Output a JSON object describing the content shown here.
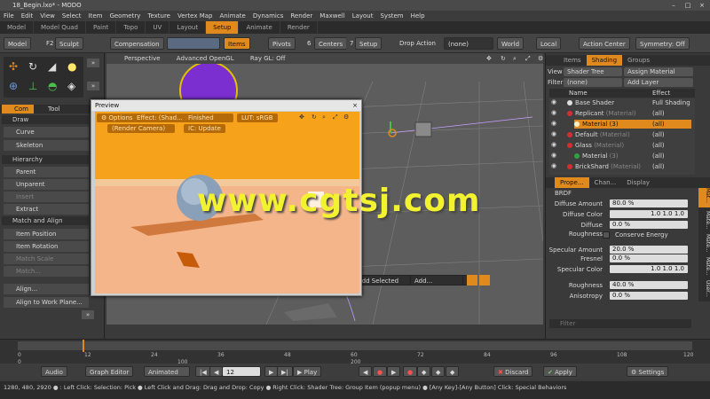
{
  "window": {
    "title": "18_Begin.lxo* - MODO",
    "controls": [
      "minimize",
      "maximize",
      "close"
    ]
  },
  "menu": [
    "File",
    "Edit",
    "View",
    "Select",
    "Item",
    "Geometry",
    "Texture",
    "Vertex Map",
    "Animate",
    "Dynamics",
    "Render",
    "Maxwell",
    "Layout",
    "System",
    "Help"
  ],
  "layout_tabs": [
    {
      "label": "Model",
      "active": false
    },
    {
      "label": "Model Quad",
      "active": false
    },
    {
      "label": "Paint",
      "active": false
    },
    {
      "label": "Topo",
      "active": false
    },
    {
      "label": "UV",
      "active": false
    },
    {
      "label": "Layout",
      "active": false
    },
    {
      "label": "Setup",
      "active": true
    },
    {
      "label": "Animate",
      "active": false
    },
    {
      "label": "Render",
      "active": false
    }
  ],
  "toolbar": {
    "model": "Model",
    "model_key": "F2",
    "sculpt": "Sculpt",
    "compensation": "Compensation",
    "items": "Items",
    "pivots": "Pivots",
    "pivots_num": "6",
    "centers": "Centers",
    "centers_num": "7",
    "setup": "Setup",
    "drop_action": "Drop Action",
    "drop_value": "(none)",
    "world": "World",
    "local": "Local",
    "action_center": "Action Center",
    "symmetry": "Symmetry: Off"
  },
  "left_panel": {
    "tabs": [
      "Com",
      "Tool"
    ],
    "sections": [
      {
        "header": "Draw",
        "items": [
          {
            "label": "Curve",
            "dim": false
          },
          {
            "label": "Skeleton",
            "dim": false
          }
        ]
      },
      {
        "header": "Hierarchy",
        "items": [
          {
            "label": "Parent",
            "dim": false
          },
          {
            "label": "Unparent",
            "dim": false
          },
          {
            "label": "Insert",
            "dim": true
          },
          {
            "label": "Extract",
            "dim": false
          }
        ]
      },
      {
        "header": "Match and Align",
        "items": [
          {
            "label": "Item Position",
            "dim": false
          },
          {
            "label": "Item Rotation",
            "dim": false
          },
          {
            "label": "Match Scale",
            "dim": true
          },
          {
            "label": "Match...",
            "dim": true
          }
        ]
      },
      {
        "header": "",
        "items": [
          {
            "label": "Align...",
            "dim": false
          },
          {
            "label": "Align to Work Plane...",
            "dim": false
          }
        ]
      }
    ]
  },
  "viewport": {
    "labels": [
      "Perspective",
      "Advanced OpenGL",
      "Ray GL: Off"
    ],
    "bottom_buttons": [
      "Add Selected",
      "Add..."
    ]
  },
  "preview": {
    "title": "Preview",
    "options": "Options",
    "effect": "Effect: (Shad...",
    "status": "Finished",
    "lut": "LUT: sRGB",
    "camera": "(Render Camera)",
    "ic": "IC: Update"
  },
  "right_panel": {
    "top_tabs": [
      {
        "label": "Items",
        "active": false
      },
      {
        "label": "Shading",
        "active": true
      },
      {
        "label": "Groups",
        "active": false
      }
    ],
    "view_label": "View",
    "view_value": "Shader Tree",
    "assign_material": "Assign Material",
    "filter_label": "Filter",
    "filter_value": "(none)",
    "add_layer": "Add Layer",
    "col_name": "Name",
    "col_effect": "Effect",
    "tree": [
      {
        "name": "Base Shader",
        "type": "",
        "effect": "Full Shading",
        "color": "#dddddd",
        "indent": 0,
        "selected": false
      },
      {
        "name": "Replicant",
        "type": "(Material)",
        "effect": "(all)",
        "color": "#d03030",
        "indent": 0,
        "selected": false
      },
      {
        "name": "Material",
        "type": "(3)",
        "effect": "(all)",
        "color": "#e08a1e",
        "indent": 1,
        "selected": true
      },
      {
        "name": "Default",
        "type": "(Material)",
        "effect": "(all)",
        "color": "#d03030",
        "indent": 0,
        "selected": false
      },
      {
        "name": "Glass",
        "type": "(Material)",
        "effect": "(all)",
        "color": "#d03030",
        "indent": 0,
        "selected": false
      },
      {
        "name": "Material",
        "type": "(3)",
        "effect": "(all)",
        "color": "#30a040",
        "indent": 1,
        "selected": false
      },
      {
        "name": "BrickShard",
        "type": "(Material)",
        "effect": "(all)",
        "color": "#d03030",
        "indent": 0,
        "selected": false
      }
    ],
    "prop_tabs": [
      {
        "label": "Prope...",
        "active": true
      },
      {
        "label": "Chan...",
        "active": false
      },
      {
        "label": "Display",
        "active": false
      }
    ],
    "section": "BRDF",
    "properties": [
      {
        "label": "Diffuse Amount",
        "value": "80.0 %"
      },
      {
        "label": "Diffuse Color",
        "value": "1.0    1.0    1.0"
      },
      {
        "label": "Diffuse Roughness",
        "value": "0.0 %"
      },
      {
        "label": "",
        "value": "Conserve Energy"
      },
      {
        "label": "Specular Amount",
        "value": "20.0 %"
      },
      {
        "label": "Fresnel",
        "value": "0.0 %"
      },
      {
        "label": "Specular Color",
        "value": "1.0    1.0    1.0"
      },
      {
        "label": "Roughness",
        "value": "40.0 %"
      },
      {
        "label": "Anisotropy",
        "value": "0.0 %"
      }
    ],
    "side_tabs": [
      "Mat...",
      "Mate...",
      "Mate...",
      "Mate...",
      "User..."
    ],
    "filter_placeholder": "Filter"
  },
  "timeline": {
    "ticks": [
      "0",
      "12",
      "24",
      "36",
      "48",
      "60",
      "72",
      "84",
      "96",
      "108",
      "120"
    ],
    "footer_ticks": [
      "0",
      "100",
      "200"
    ]
  },
  "transport": {
    "audio": "Audio",
    "graph_editor": "Graph Editor",
    "animated": "Animated",
    "frame": "12",
    "play": "Play",
    "discard": "Discard",
    "apply": "Apply",
    "settings": "Settings"
  },
  "status": "1280, 480, 2920 ● : Left Click: Selection: Pick ● Left Click and Drag: Drag and Drop: Copy ● Right Click: Shader Tree: Group Item (popup menu) ● [Any Key]-[Any Button] Click: Special Behaviors",
  "watermark": "www.cgtsj.com",
  "colors": {
    "accent": "#e08a1e",
    "preview_bg": "#f7a21b",
    "floor": "#f4b58a",
    "watermark": "#f2f230"
  }
}
